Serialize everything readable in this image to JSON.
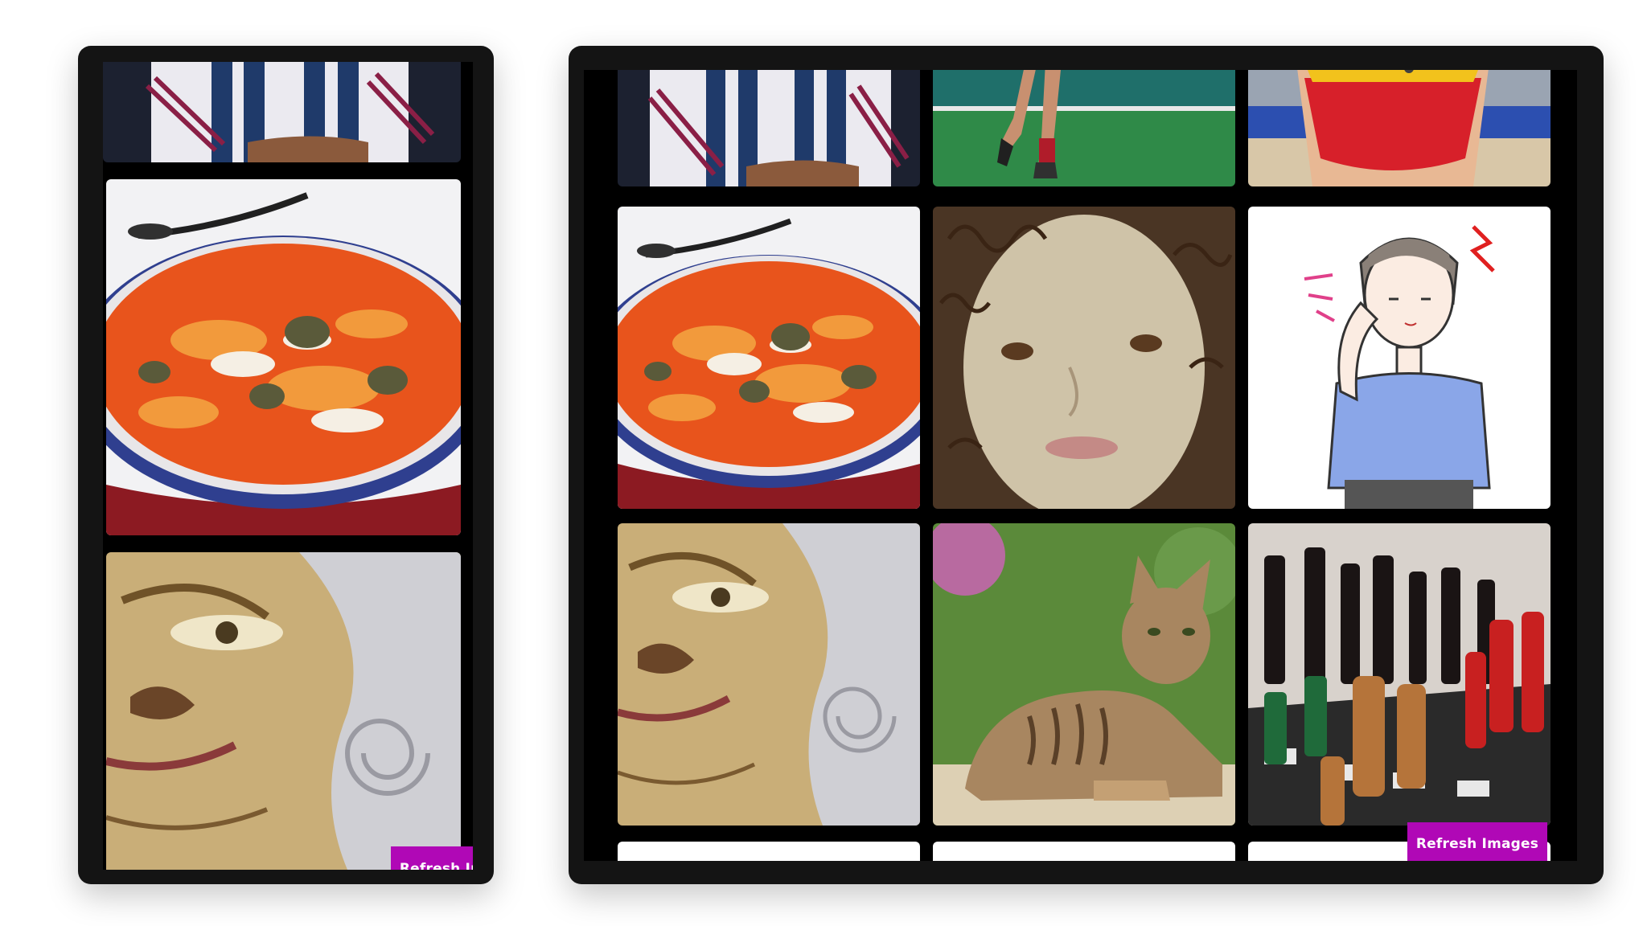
{
  "mobile_gallery": {
    "images": [
      {
        "name": "striped-shirt-photo"
      },
      {
        "name": "seafood-soup-photo"
      },
      {
        "name": "swirl-face-painting"
      }
    ],
    "refresh_label": "Refresh Images"
  },
  "desktop_gallery": {
    "images": [
      {
        "name": "striped-shirt-photo"
      },
      {
        "name": "runner-legs-photo"
      },
      {
        "name": "athlete-red-uniform-photo"
      },
      {
        "name": "seafood-soup-photo"
      },
      {
        "name": "textured-girl-face-painting"
      },
      {
        "name": "headache-woman-illustration"
      },
      {
        "name": "swirl-face-painting"
      },
      {
        "name": "tabby-cat-photo"
      },
      {
        "name": "chess-pieces-photo"
      }
    ],
    "refresh_label": "Refresh Images"
  },
  "colors": {
    "button": "#b008b6",
    "frame": "#141414",
    "screen": "#000000"
  }
}
